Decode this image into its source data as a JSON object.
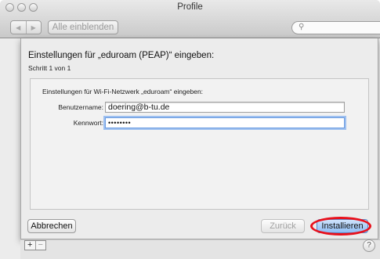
{
  "window": {
    "title": "Profile"
  },
  "toolbar": {
    "back_icon": "chevron-left-icon",
    "forward_icon": "chevron-right-icon",
    "show_all_label": "Alle einblenden",
    "search_placeholder": ""
  },
  "sheet": {
    "heading": "Einstellungen für „eduroam (PEAP)“ eingeben:",
    "step": "Schritt 1 von 1",
    "network_hint": "Einstellungen für Wi-Fi-Netzwerk „eduroam“ eingeben:",
    "username_label": "Benutzername:",
    "username_value": "doering@b-tu.de",
    "password_label": "Kennwort:",
    "password_value": "••••••••",
    "cancel_label": "Abbrechen",
    "back_label": "Zurück",
    "install_label": "Installieren"
  },
  "bottom": {
    "add_label": "+",
    "remove_label": "−",
    "help_label": "?"
  },
  "colors": {
    "highlight_ring": "#e8101b",
    "focus_ring": "#9ec0f0"
  }
}
